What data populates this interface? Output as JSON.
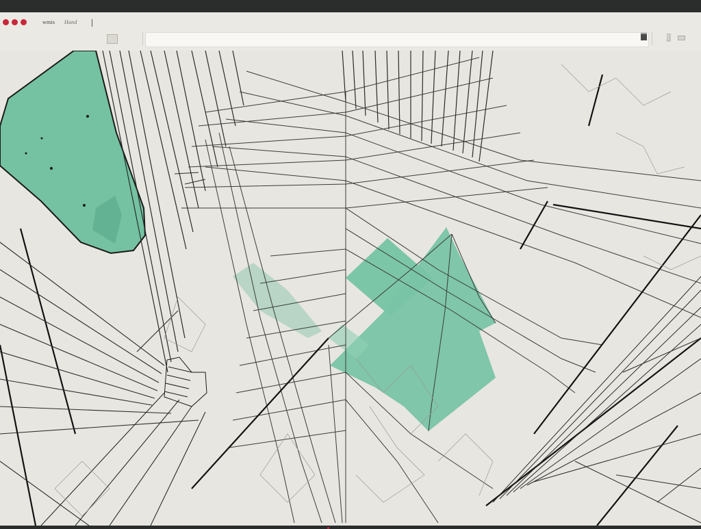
{
  "window": {
    "title": "wmis",
    "subtitle": "Hand",
    "address_value": "",
    "address_placeholder": ""
  },
  "colors": {
    "close": "#c8283a",
    "minimize": "#c8283a",
    "maximize": "#c8283a",
    "canvas_background": "#e8e6e0",
    "accent_fill": "#6fbfa0",
    "ink": "#1a1a1a"
  },
  "icons": {
    "close": "close-dot-icon",
    "minimize": "minimize-dot-icon",
    "maximize": "maximize-dot-icon",
    "address_action": "share-icon",
    "sidebar_toggle": "sidebar-icon",
    "panel_toggle": "panel-icon"
  }
}
